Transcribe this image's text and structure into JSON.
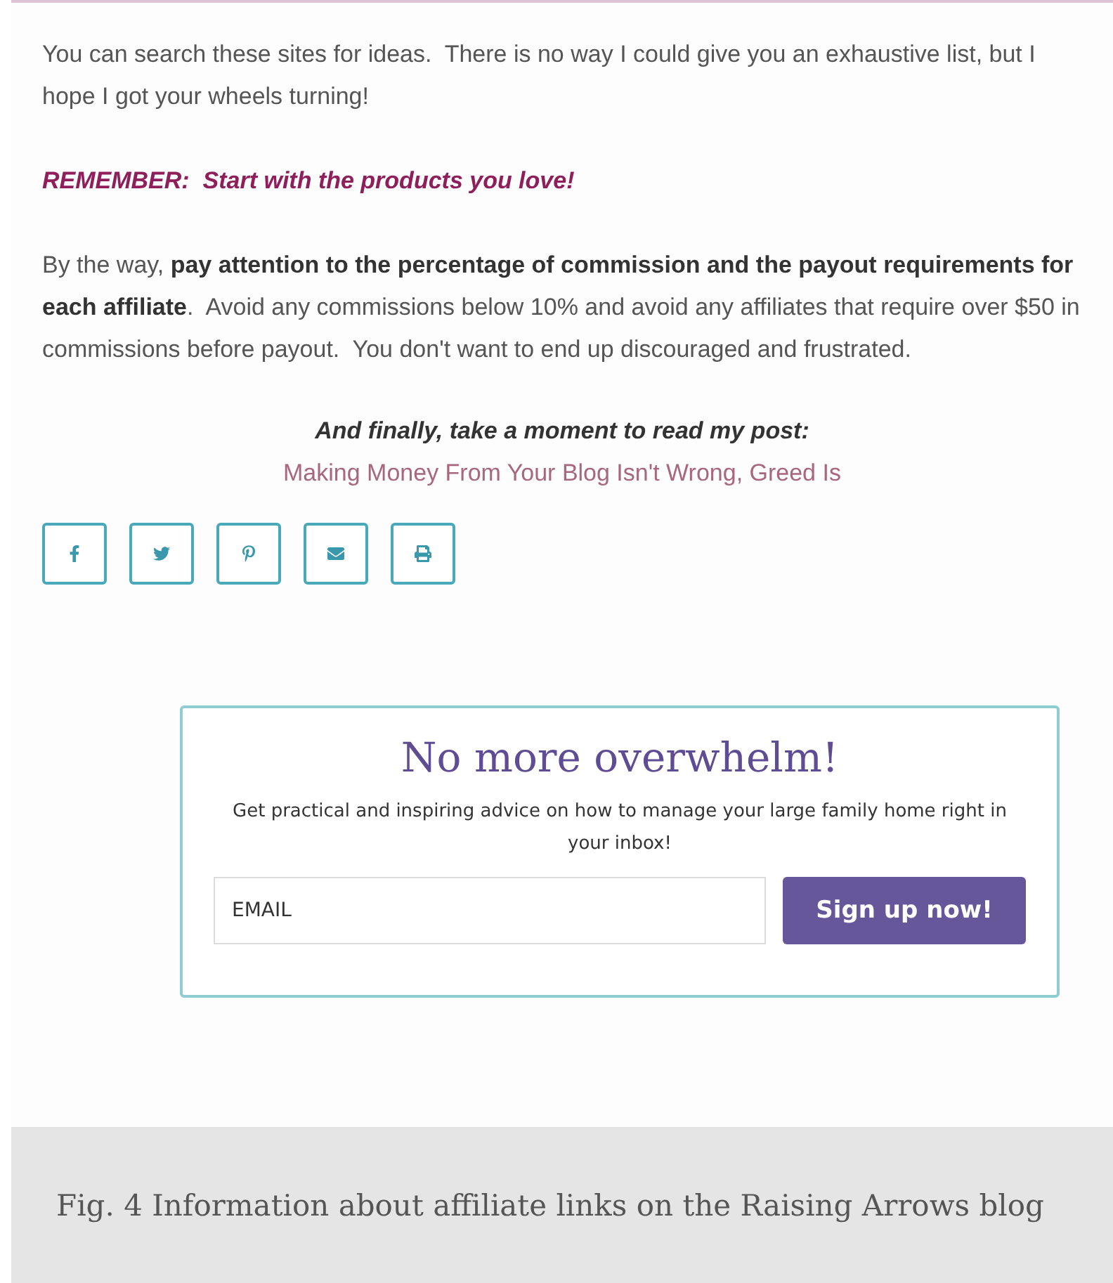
{
  "article": {
    "paragraphs": [
      "You can search these sites for ideas.  There is no way I could give you an exhaustive list, but I hope I got your wheels turning!"
    ],
    "reminder": "REMEMBER:  Start with the products you love!",
    "note": "By the way, **pay attention to the percentage of commission and the payout requirements for each affiliate**.  Avoid any commissions below 10% and avoid any affiliates that require over $50 in commissions before payout.  You don't want to end up discouraged and frustrated.",
    "closing": "And finally, take a moment to read my post:",
    "post_link": "Making Money From Your Blog Isn't Wrong, Greed Is"
  },
  "share_buttons": [
    {
      "kind": "facebook"
    },
    {
      "kind": "twitter"
    },
    {
      "kind": "pinterest"
    },
    {
      "kind": "email"
    },
    {
      "kind": "print"
    }
  ],
  "signup": {
    "title": "No more overwhelm!",
    "description": "Get practical and inspiring advice on how to manage your large family home right in your inbox!",
    "email": {
      "placeholder": "EMAIL"
    },
    "button": "Sign up now!"
  },
  "caption": "Fig. 4 Information about affiliate links on the Raising Arrows blog"
}
